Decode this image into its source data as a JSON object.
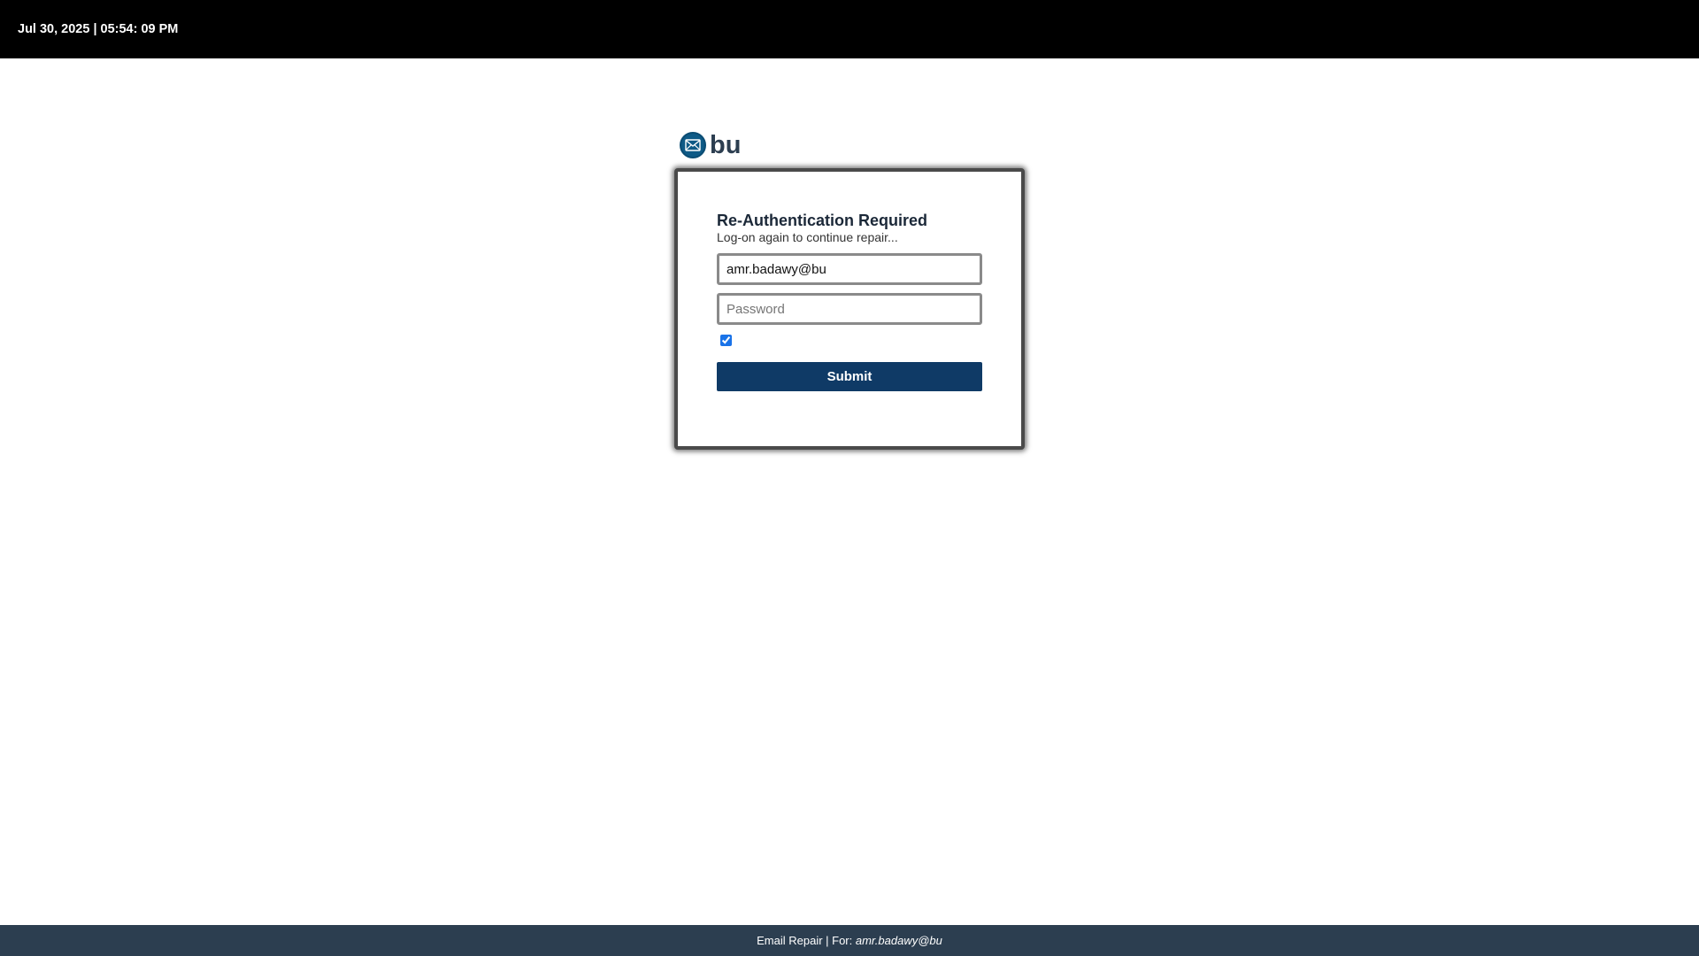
{
  "header": {
    "datetime": "Jul 30, 2025 | 05:54: 09 PM"
  },
  "brand": {
    "icon": "envelope-icon",
    "name": "bu",
    "color": "#0e5a86"
  },
  "login_card": {
    "title": "Re-Authentication Required",
    "subtitle": "Log-on again to continue repair...",
    "email_value": "amr.badawy@bu",
    "password_placeholder": "Password",
    "remember_checked": true,
    "submit_label": "Submit",
    "submit_color": "#0f3a66"
  },
  "footer": {
    "prefix": "Email Repair | For: ",
    "email": "amr.badawy@bu",
    "background": "#2c3e50"
  }
}
